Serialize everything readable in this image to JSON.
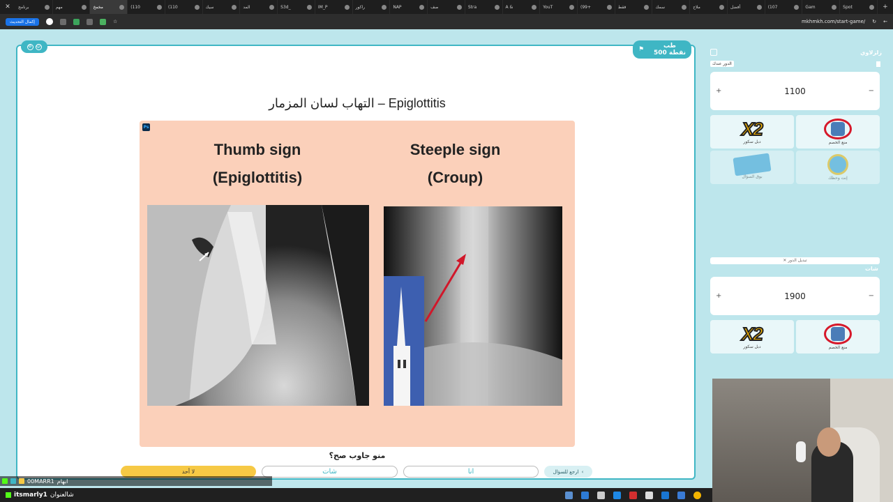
{
  "browser": {
    "tabs": [
      {
        "label": "برنامج",
        "active": false
      },
      {
        "label": "مهم",
        "active": false
      },
      {
        "label": "مخمخ",
        "active": true
      },
      {
        "label": "(110",
        "active": false
      },
      {
        "label": "(110",
        "active": false
      },
      {
        "label": "سيك",
        "active": false
      },
      {
        "label": "المد",
        "active": false
      },
      {
        "label": "S3d_",
        "active": false
      },
      {
        "label": "IM_P",
        "active": false
      },
      {
        "label": "راكور",
        "active": false
      },
      {
        "label": "NAP",
        "active": false
      },
      {
        "label": "صف",
        "active": false
      },
      {
        "label": "Stra",
        "active": false
      },
      {
        "label": "A &",
        "active": false
      },
      {
        "label": "YouT",
        "active": false
      },
      {
        "label": "(99+",
        "active": false
      },
      {
        "label": "فقط",
        "active": false
      },
      {
        "label": "سمك",
        "active": false
      },
      {
        "label": "ملاح",
        "active": false
      },
      {
        "label": "أفضل",
        "active": false
      },
      {
        "label": "(107",
        "active": false
      },
      {
        "label": "Gam",
        "active": false
      },
      {
        "label": "Spot",
        "active": false
      }
    ],
    "new_tab": "+",
    "update_chip": "إكمال التحديث",
    "url": "mkhmkh.com/start-game/"
  },
  "game": {
    "team_badge": {
      "name": "طب",
      "points": "500 نقطة"
    },
    "question_title": "التهاب لسان المزمار – Epiglottitis",
    "image": {
      "left_sign": [
        "Thumb sign",
        "(Epiglottitis)"
      ],
      "right_sign": [
        "Steeple sign",
        "(Croup)"
      ]
    },
    "question": "منو جاوب صح؟",
    "answers": {
      "no_one": "لا أحد",
      "team2": "شات",
      "team1": "انا",
      "back": "ارجع للسؤال"
    }
  },
  "panel": {
    "title": "زلزلاوي",
    "turn_tag": "الدور عندك",
    "team1": {
      "score": "1100",
      "plus": "+",
      "minus": "−"
    },
    "switch_turn": "✕ تبديل الدور",
    "team2": {
      "name": "شات",
      "score": "1900",
      "plus": "+",
      "minus": "−"
    },
    "helpers": [
      {
        "name": "دبل سكور",
        "icon": "x2-icon"
      },
      {
        "name": "منع الخصم",
        "icon": "no-turn-icon"
      },
      {
        "name": "بوق السؤال",
        "icon": "cards-icon"
      },
      {
        "name": "إنت وحظك",
        "icon": "clock-icon"
      }
    ]
  },
  "chat": {
    "line1_user": "00MARR1",
    "line1_msg": "ابهام",
    "line2_user": "itsmarly1",
    "line2_msg": "شالعنوان"
  },
  "colors": {
    "accent": "#3fb6c4",
    "page_bg": "#bde6ec",
    "image_bg": "#fbd0ba",
    "no_one": "#f6c945"
  }
}
